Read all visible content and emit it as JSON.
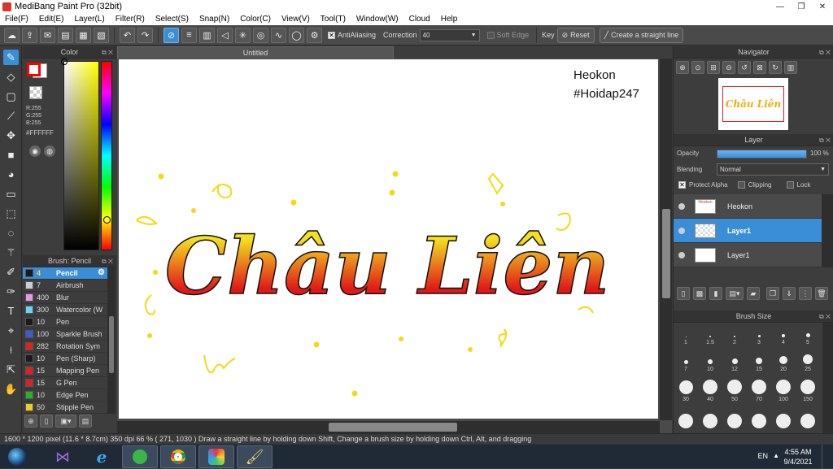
{
  "window": {
    "title": "MediBang Paint Pro (32bit)",
    "minimize": "—",
    "restore": "❐",
    "close": "✕"
  },
  "menu": [
    "File(F)",
    "Edit(E)",
    "Layer(L)",
    "Filter(R)",
    "Select(S)",
    "Snap(N)",
    "Color(C)",
    "View(V)",
    "Tool(T)",
    "Window(W)",
    "Cloud",
    "Help"
  ],
  "toolbar": {
    "antialiasing_label": "AntiAliasing",
    "antialiasing_checked": true,
    "correction_label": "Correction",
    "correction_value": "40",
    "soft_edge_label": "Soft Edge",
    "soft_edge_checked": false,
    "key_label": "Key",
    "reset_label": "Reset",
    "straight_line_label": "Create a straight line"
  },
  "color_panel": {
    "title": "Color",
    "r": "R:255",
    "g": "G:255",
    "b": "B:255",
    "hex": "#FFFFFF",
    "foreground": "#ff0000",
    "background": "#ffffff"
  },
  "brush_panel": {
    "title": "Brush: Pencil",
    "brushes": [
      {
        "size": "4",
        "name": "Pencil",
        "color": "#1a1a1a",
        "active": true
      },
      {
        "size": "7",
        "name": "Airbrush",
        "color": "#cccccc"
      },
      {
        "size": "400",
        "name": "Blur",
        "color": "#e29ae8"
      },
      {
        "size": "300",
        "name": "Watercolor (W",
        "color": "#6fd0f0"
      },
      {
        "size": "10",
        "name": "Pen",
        "color": "#1a1a1a"
      },
      {
        "size": "100",
        "name": "Sparkle Brush",
        "color": "#3a5ad8"
      },
      {
        "size": "282",
        "name": "Rotation Sym",
        "color": "#e02020"
      },
      {
        "size": "10",
        "name": "Pen (Sharp)",
        "color": "#1a1a1a"
      },
      {
        "size": "15",
        "name": "Mapping Pen",
        "color": "#e02020"
      },
      {
        "size": "15",
        "name": "G Pen",
        "color": "#e02020"
      },
      {
        "size": "10",
        "name": "Edge Pen",
        "color": "#2ab02a"
      },
      {
        "size": "50",
        "name": "Stipple Pen",
        "color": "#e8d020"
      }
    ]
  },
  "document": {
    "tab": "Untitled",
    "signature_line1": "Heokon",
    "signature_line2": "#Hoidap247",
    "lettering": "Châu Liên"
  },
  "navigator": {
    "title": "Navigator",
    "preview_text": "Châu Liên"
  },
  "layer_panel": {
    "title": "Layer",
    "opacity_label": "Opacity",
    "opacity_value": "100 %",
    "opacity_fraction": 1.0,
    "blending_label": "Blending",
    "blending_value": "Normal",
    "protect_alpha_label": "Protect Alpha",
    "clipping_label": "Clipping",
    "lock_label": "Lock",
    "layers": [
      {
        "name": "Heokon",
        "active": false
      },
      {
        "name": "Layer1",
        "active": true
      },
      {
        "name": "Layer1",
        "active": false
      }
    ]
  },
  "brush_size_panel": {
    "title": "Brush Size",
    "sizes": [
      "1",
      "1.5",
      "2",
      "3",
      "4",
      "5",
      "7",
      "10",
      "12",
      "15",
      "20",
      "25",
      "30",
      "40",
      "50",
      "70",
      "100",
      "150"
    ]
  },
  "status": {
    "text": "1600 * 1200 pixel   (11.6 * 8.7cm)   350 dpi   66 %   ( 271, 1030 )   Draw a straight line by holding down Shift, Change a brush size by holding down Ctrl, Alt, and dragging"
  },
  "taskbar": {
    "lang": "EN",
    "time": "4:55 AM",
    "date": "9/4/2021"
  },
  "colors": {
    "accent": "#3a8ed8",
    "panel": "#3d3d3d",
    "lettering_top": "#f5e020",
    "lettering_bottom": "#e01818"
  }
}
